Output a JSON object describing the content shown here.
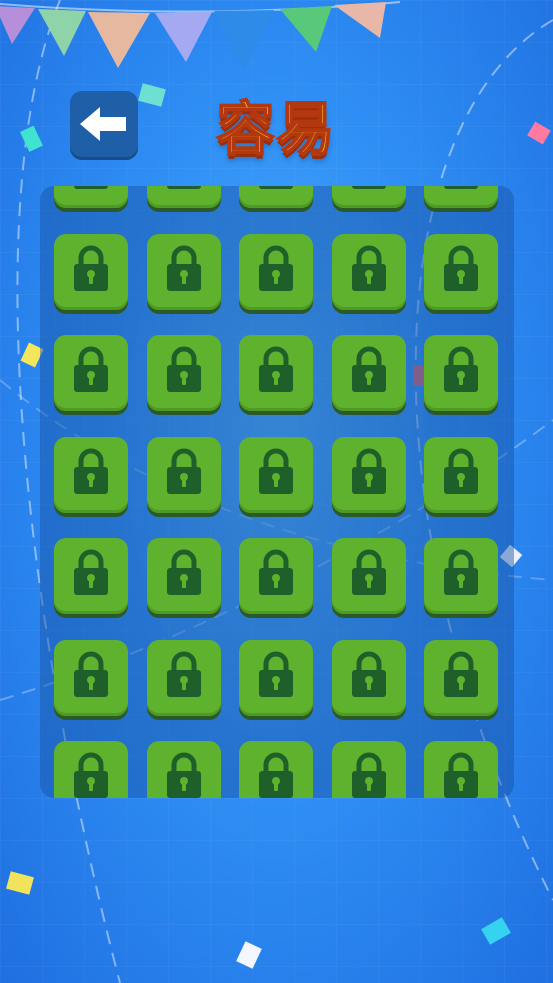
{
  "title": "容易",
  "back_icon": "arrow-left-icon",
  "lock_icon": "lock-icon",
  "grid": {
    "columns": 5,
    "rows": [
      [
        "locked",
        "locked",
        "locked",
        "locked",
        "locked"
      ],
      [
        "locked",
        "locked",
        "locked",
        "locked",
        "locked"
      ],
      [
        "locked",
        "locked",
        "locked",
        "locked",
        "locked"
      ],
      [
        "locked",
        "locked",
        "locked",
        "locked",
        "locked"
      ],
      [
        "locked",
        "locked",
        "locked",
        "locked",
        "locked"
      ],
      [
        "locked",
        "locked",
        "locked",
        "locked",
        "locked"
      ],
      [
        "locked",
        "locked",
        "locked",
        "locked",
        "locked"
      ],
      [
        "locked",
        "locked",
        "locked",
        "locked",
        "locked"
      ]
    ]
  },
  "colors": {
    "tile": "#5fb22e",
    "lock": "#1f5f2a",
    "title_fill": "#ffd21f",
    "title_outline": "#b3380f",
    "back_button": "#1e5fa8"
  }
}
